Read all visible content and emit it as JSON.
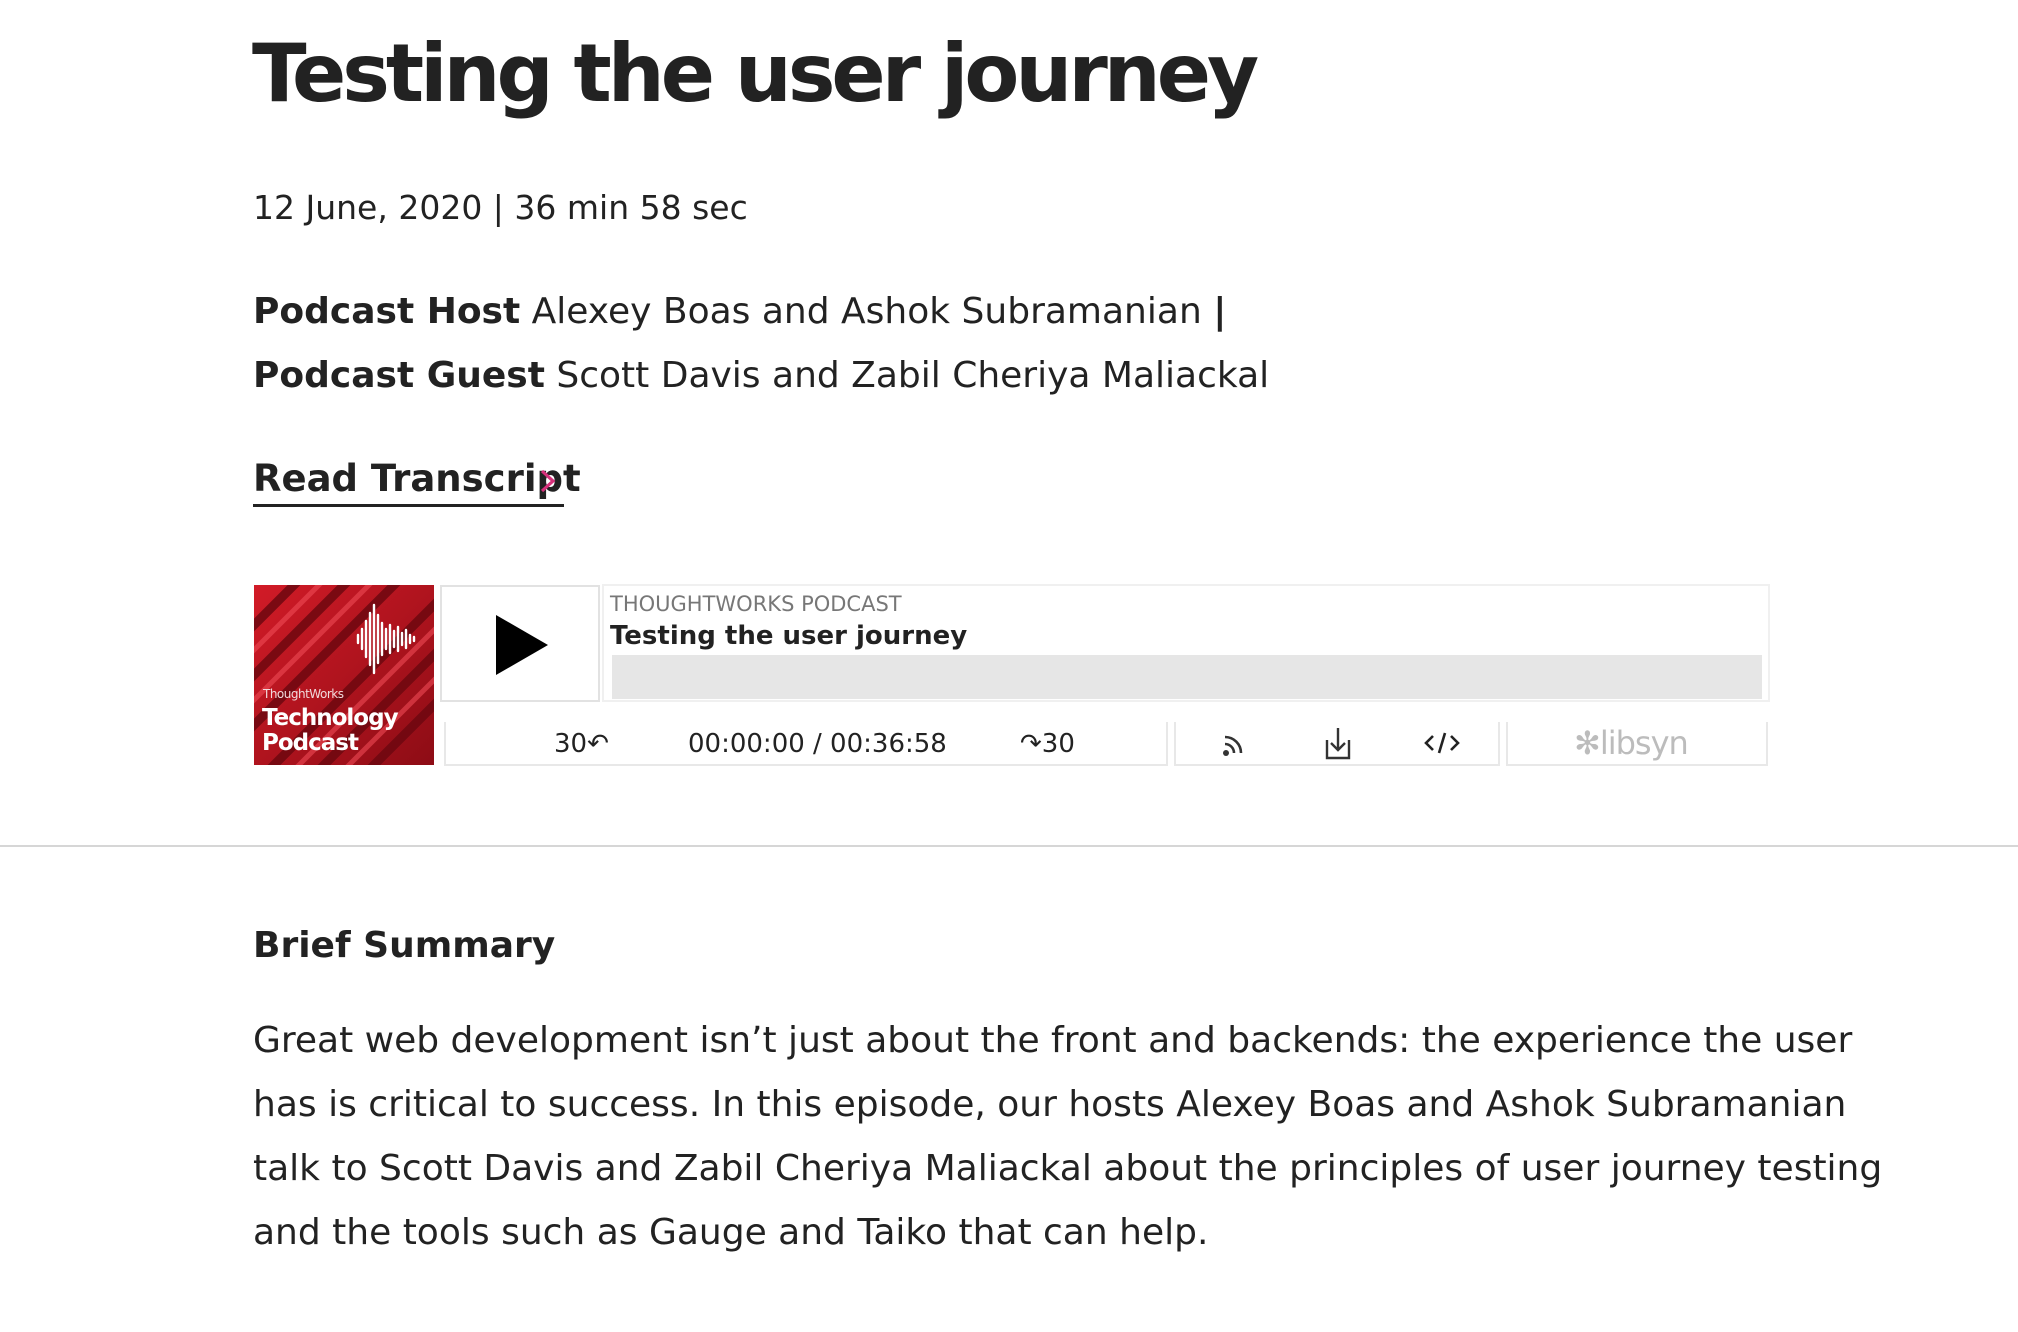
{
  "episode": {
    "title": "Testing the user journey",
    "meta": "12 June, 2020 | 36 min 58 sec",
    "host_label": "Podcast Host",
    "host_names": "Alexey Boas and Ashok Subramanian",
    "host_separator": "|",
    "guest_label": "Podcast Guest",
    "guest_names": "Scott Davis and Zabil Cheriya Maliackal",
    "transcript_link": "Read Transcript"
  },
  "player": {
    "cover_brand": "ThoughtWorks",
    "cover_line1": "Technology",
    "cover_line2": "Podcast",
    "podcast_name": "THOUGHTWORKS PODCAST",
    "episode_title": "Testing the user journey",
    "progress_fraction": 0,
    "skip_back": "30↶",
    "time_readout": "00:00:00 / 00:36:58",
    "skip_forward": "↷30",
    "brand": "libsyn",
    "icons": [
      "play-icon",
      "rss-icon",
      "download-icon",
      "embed-code-icon",
      "libsyn-logo"
    ],
    "colors": {
      "cover_red": "#b0121c",
      "accent_pink": "#d6307a",
      "progress_track": "#e6e6e6"
    }
  },
  "summary": {
    "heading": "Brief Summary",
    "lines": [
      "Great web development isn’t just about the front and backends: the experience the user",
      "has is critical to success. In this episode, our hosts Alexey Boas and Ashok Subramanian",
      "talk to Scott Davis and Zabil Cheriya Maliackal about the principles of user journey testing",
      "and the tools such as Gauge and Taiko that can help."
    ]
  }
}
